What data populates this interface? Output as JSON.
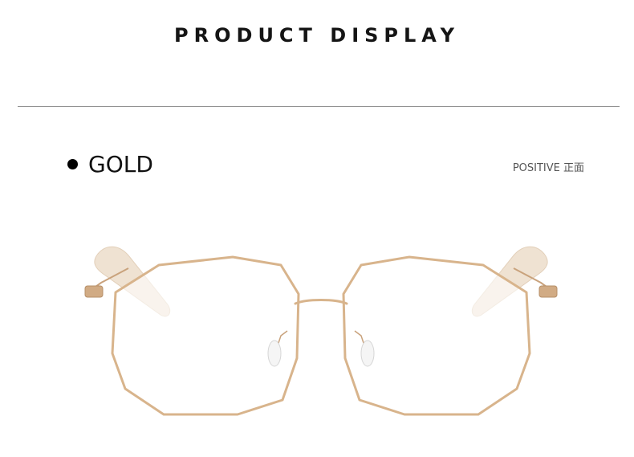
{
  "header": {
    "title": "PRODUCT DISPLAY"
  },
  "product": {
    "color_name": "GOLD",
    "view_label": "POSITIVE 正面",
    "image_subject": "gold-frame-eyeglasses-front",
    "frame_color": "#d8b48c",
    "temple_tip_color": "#ecdcc8"
  }
}
